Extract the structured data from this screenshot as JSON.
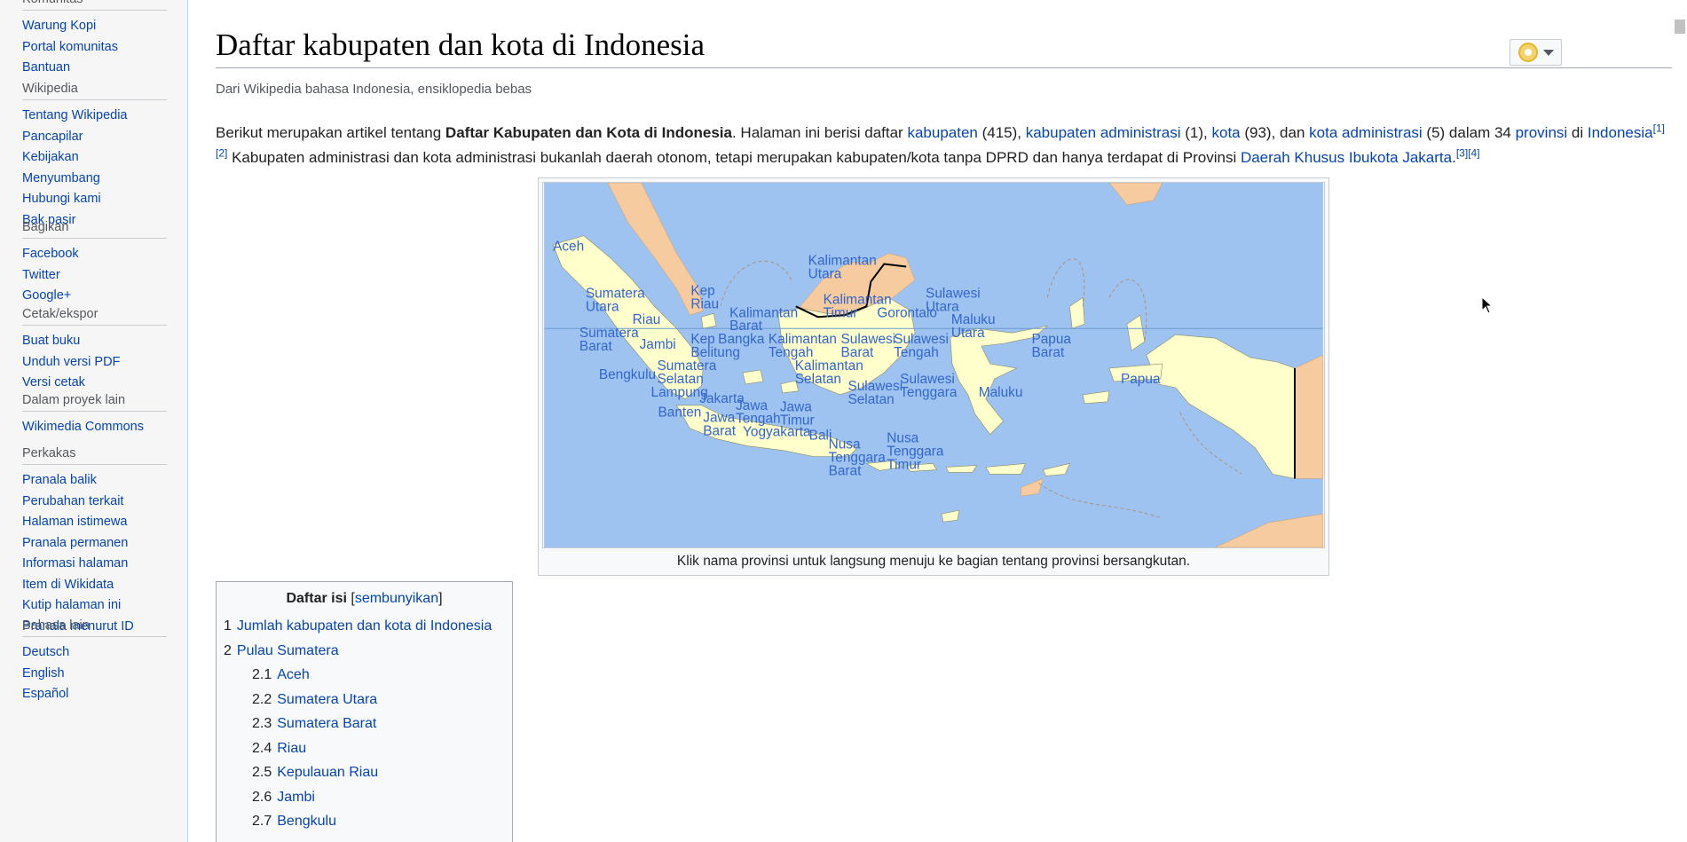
{
  "sidebar": {
    "sections": [
      {
        "heading": "Komunitas",
        "items": [
          "Warung Kopi",
          "Portal komunitas",
          "Bantuan"
        ]
      },
      {
        "heading": "Wikipedia",
        "items": [
          "Tentang Wikipedia",
          "Pancapilar",
          "Kebijakan",
          "Menyumbang",
          "Hubungi kami",
          "Bak pasir"
        ]
      },
      {
        "heading": "Bagikan",
        "items": [
          "Facebook",
          "Twitter",
          "Google+"
        ]
      },
      {
        "heading": "Cetak/ekspor",
        "items": [
          "Buat buku",
          "Unduh versi PDF",
          "Versi cetak"
        ]
      },
      {
        "heading": "Dalam proyek lain",
        "items": [
          "Wikimedia Commons"
        ]
      },
      {
        "heading": "Perkakas",
        "items": [
          "Pranala balik",
          "Perubahan terkait",
          "Halaman istimewa",
          "Pranala permanen",
          "Informasi halaman",
          "Item di Wikidata",
          "Kutip halaman ini",
          "Pranala menurut ID"
        ]
      },
      {
        "heading": "Bahasa lain",
        "items": [
          "Deutsch",
          "English",
          "Español"
        ]
      }
    ],
    "settings_icon": "gear-icon"
  },
  "page": {
    "title": "Daftar kabupaten dan kota di Indonesia",
    "subtitle": "Dari Wikipedia bahasa Indonesia, ensiklopedia bebas",
    "watch_icon": "eye-icon"
  },
  "intro": {
    "t1": "Berikut merupakan artikel tentang ",
    "bold": "Daftar Kabupaten dan Kota di Indonesia",
    "t2": ". Halaman ini berisi daftar ",
    "l_kabupaten": "kabupaten",
    "t3": " (415), ",
    "l_kabadm": "kabupaten administrasi",
    "t4": " (1), ",
    "l_kota": "kota",
    "t5": " (93), dan ",
    "l_kotaadm": "kota administrasi",
    "t6": " (5) dalam 34 ",
    "l_provinsi": "provinsi",
    "t7": " di ",
    "l_indonesia": "Indonesia",
    "ref1": "[1]",
    "ref2": "[2]",
    "t8": " Kabupaten administrasi dan kota administrasi bukanlah daerah otonom, tetapi merupakan kabupaten/kota tanpa DPRD dan hanya terdapat di Provinsi ",
    "l_dki": "Daerah Khusus Ibukota Jakarta",
    "t9": ".",
    "ref3": "[3]",
    "ref4": "[4]"
  },
  "map": {
    "caption": "Klik nama provinsi untuk langsung menuju ke bagian tentang provinsi bersangkutan.",
    "colors": {
      "sea": "#9ec3f0",
      "land": "#ffffcc",
      "foreign": "#f7cba0",
      "label": "#3366cc"
    },
    "provinces": [
      {
        "id": "aceh",
        "lines": [
          "Aceh"
        ]
      },
      {
        "id": "sumut",
        "lines": [
          "Sumatera",
          "Utara"
        ]
      },
      {
        "id": "riau",
        "lines": [
          "Riau"
        ]
      },
      {
        "id": "kepriau",
        "lines": [
          "Kep",
          "Riau"
        ]
      },
      {
        "id": "sumbar",
        "lines": [
          "Sumatera",
          "Barat"
        ]
      },
      {
        "id": "jambi",
        "lines": [
          "Jambi"
        ]
      },
      {
        "id": "babel",
        "lines": [
          "Kep",
          "Belitung"
        ]
      },
      {
        "id": "bangka",
        "lines": [
          "Bangka"
        ]
      },
      {
        "id": "bengkulu",
        "lines": [
          "Bengkulu"
        ]
      },
      {
        "id": "sumsel",
        "lines": [
          "Sumatera",
          "Selatan"
        ]
      },
      {
        "id": "lampung",
        "lines": [
          "Lampung"
        ]
      },
      {
        "id": "banten",
        "lines": [
          "Banten"
        ]
      },
      {
        "id": "jakarta",
        "lines": [
          "Jakarta"
        ]
      },
      {
        "id": "jabar",
        "lines": [
          "Jawa",
          "Barat"
        ]
      },
      {
        "id": "jateng",
        "lines": [
          "Jawa",
          "Tengah"
        ]
      },
      {
        "id": "jatim",
        "lines": [
          "Jawa",
          "Timur"
        ]
      },
      {
        "id": "yogya",
        "lines": [
          "Yogyakarta"
        ]
      },
      {
        "id": "bali",
        "lines": [
          "Bali"
        ]
      },
      {
        "id": "ntb",
        "lines": [
          "Nusa",
          "Tenggara",
          "Barat"
        ]
      },
      {
        "id": "ntt",
        "lines": [
          "Nusa",
          "Tenggara",
          "Timur"
        ]
      },
      {
        "id": "kalbar",
        "lines": [
          "Kalimantan",
          "Barat"
        ]
      },
      {
        "id": "kalteng",
        "lines": [
          "Kalimantan",
          "Tengah"
        ]
      },
      {
        "id": "kalsel",
        "lines": [
          "Kalimantan",
          "Selatan"
        ]
      },
      {
        "id": "kaltim",
        "lines": [
          "Kalimantan",
          "Timur"
        ]
      },
      {
        "id": "kalut",
        "lines": [
          "Kalimantan",
          "Utara"
        ]
      },
      {
        "id": "gorontalo",
        "lines": [
          "Gorontalo"
        ]
      },
      {
        "id": "sulut",
        "lines": [
          "Sulawesi",
          "Utara"
        ]
      },
      {
        "id": "sulbar",
        "lines": [
          "Sulawesi",
          "Barat"
        ]
      },
      {
        "id": "sulteng",
        "lines": [
          "Sulawesi",
          "Tengah"
        ]
      },
      {
        "id": "sulsel",
        "lines": [
          "Sulawesi",
          "Selatan"
        ]
      },
      {
        "id": "sultra",
        "lines": [
          "Sulawesi",
          "Tenggara"
        ]
      },
      {
        "id": "malut",
        "lines": [
          "Maluku",
          "Utara"
        ]
      },
      {
        "id": "maluku",
        "lines": [
          "Maluku"
        ]
      },
      {
        "id": "papbar",
        "lines": [
          "Papua",
          "Barat"
        ]
      },
      {
        "id": "papua",
        "lines": [
          "Papua"
        ]
      }
    ]
  },
  "toc": {
    "title": "Daftar isi",
    "toggle_open": " [",
    "toggle": "sembunyikan",
    "toggle_close": "]",
    "items": [
      {
        "num": "1",
        "text": "Jumlah kabupaten dan kota di Indonesia",
        "level": 1
      },
      {
        "num": "2",
        "text": "Pulau Sumatera",
        "level": 1
      },
      {
        "num": "2.1",
        "text": "Aceh",
        "level": 2
      },
      {
        "num": "2.2",
        "text": "Sumatera Utara",
        "level": 2
      },
      {
        "num": "2.3",
        "text": "Sumatera Barat",
        "level": 2
      },
      {
        "num": "2.4",
        "text": "Riau",
        "level": 2
      },
      {
        "num": "2.5",
        "text": "Kepulauan Riau",
        "level": 2
      },
      {
        "num": "2.6",
        "text": "Jambi",
        "level": 2
      },
      {
        "num": "2.7",
        "text": "Bengkulu",
        "level": 2
      }
    ]
  }
}
